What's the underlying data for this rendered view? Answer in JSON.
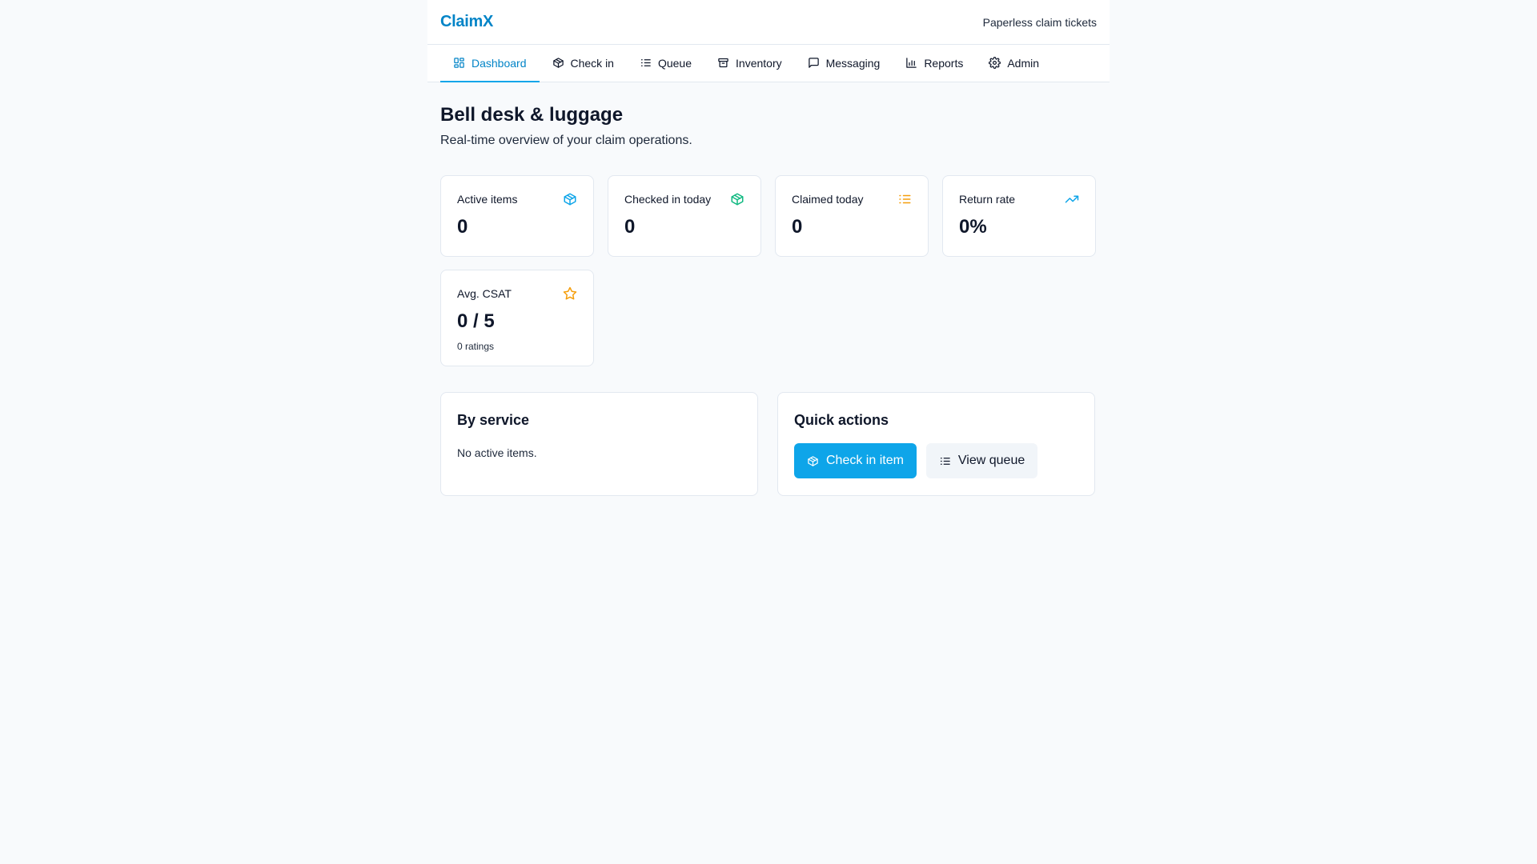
{
  "app": {
    "brand": "ClaimX",
    "tagline": "Paperless claim tickets"
  },
  "nav": [
    {
      "label": "Dashboard",
      "icon": "dashboard-icon"
    },
    {
      "label": "Check in",
      "icon": "package-icon"
    },
    {
      "label": "Queue",
      "icon": "list-icon"
    },
    {
      "label": "Inventory",
      "icon": "archive-icon"
    },
    {
      "label": "Messaging",
      "icon": "message-icon"
    },
    {
      "label": "Reports",
      "icon": "bar-chart-icon"
    },
    {
      "label": "Admin",
      "icon": "gear-icon"
    }
  ],
  "page": {
    "title": "Bell desk & luggage",
    "subtitle": "Real-time overview of your claim operations."
  },
  "stats": [
    {
      "label": "Active items",
      "value": "0",
      "icon": "package-icon",
      "color": "#0ea5e9"
    },
    {
      "label": "Checked in today",
      "value": "0",
      "icon": "package-icon",
      "color": "#10b981"
    },
    {
      "label": "Claimed today",
      "value": "0",
      "icon": "list-icon",
      "color": "#f59e0b"
    },
    {
      "label": "Return rate",
      "value": "0%",
      "icon": "trending-up-icon",
      "color": "#0ea5e9"
    },
    {
      "label": "Avg. CSAT",
      "value": "0 / 5",
      "note": "0 ratings",
      "icon": "star-icon",
      "color": "#f59e0b"
    }
  ],
  "by_service": {
    "title": "By service",
    "empty": "No active items."
  },
  "quick_actions": {
    "title": "Quick actions",
    "check_in_label": "Check in item",
    "view_queue_label": "View queue"
  },
  "colors": {
    "accent": "#0ea5e9",
    "brand": "#0284c7"
  }
}
